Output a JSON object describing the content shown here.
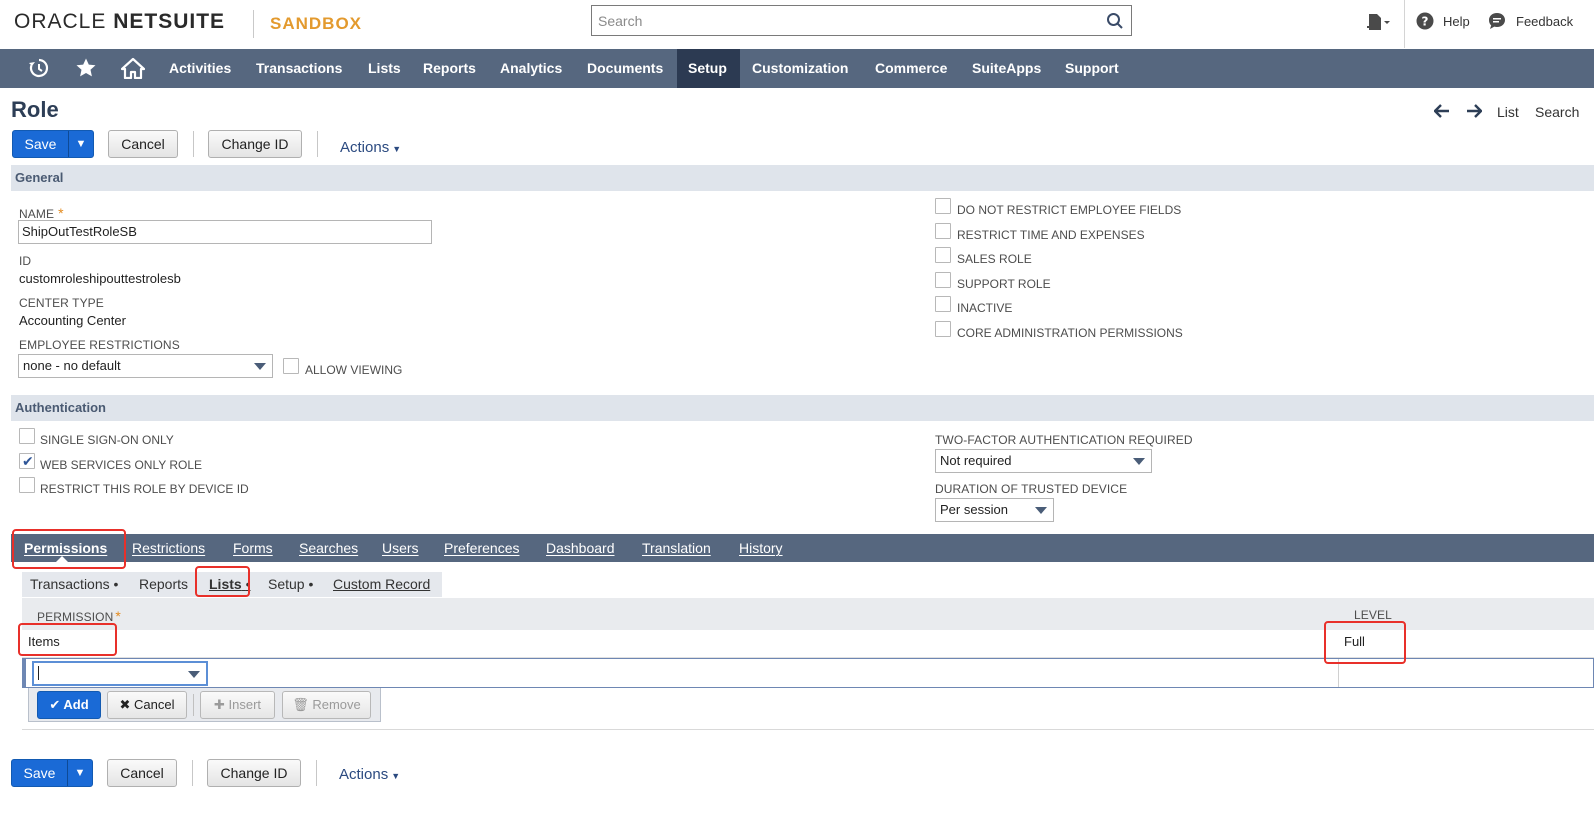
{
  "app": {
    "brand_oracle": "ORACLE",
    "brand_netsuite": "NETSUITE",
    "sandbox": "SANDBOX"
  },
  "search": {
    "placeholder": "Search"
  },
  "topbar": {
    "help": "Help",
    "feedback": "Feedback"
  },
  "nav": {
    "items": [
      {
        "label": "Activities"
      },
      {
        "label": "Transactions"
      },
      {
        "label": "Lists"
      },
      {
        "label": "Reports"
      },
      {
        "label": "Analytics"
      },
      {
        "label": "Documents"
      },
      {
        "label": "Setup",
        "active": true
      },
      {
        "label": "Customization"
      },
      {
        "label": "Commerce"
      },
      {
        "label": "SuiteApps"
      },
      {
        "label": "Support"
      }
    ]
  },
  "page": {
    "title": "Role",
    "nav_list": "List",
    "nav_search": "Search"
  },
  "toolbar": {
    "save": "Save",
    "cancel": "Cancel",
    "change_id": "Change ID",
    "actions": "Actions"
  },
  "general": {
    "header": "General",
    "name_label": "NAME",
    "name_value": "ShipOutTestRoleSB",
    "id_label": "ID",
    "id_value": "customroleshipouttestrolesb",
    "center_type_label": "CENTER TYPE",
    "center_type_value": "Accounting Center",
    "employee_restrictions_label": "EMPLOYEE RESTRICTIONS",
    "employee_restrictions_value": "none - no default",
    "allow_viewing": "ALLOW VIEWING",
    "checkboxes": [
      {
        "label": "DO NOT RESTRICT EMPLOYEE FIELDS",
        "checked": false
      },
      {
        "label": "RESTRICT TIME AND EXPENSES",
        "checked": false
      },
      {
        "label": "SALES ROLE",
        "checked": false
      },
      {
        "label": "SUPPORT ROLE",
        "checked": false
      },
      {
        "label": "INACTIVE",
        "checked": false
      },
      {
        "label": "CORE ADMINISTRATION PERMISSIONS",
        "checked": false
      }
    ]
  },
  "authentication": {
    "header": "Authentication",
    "sso": "SINGLE SIGN-ON ONLY",
    "web_services": "WEB SERVICES ONLY ROLE",
    "device_id": "RESTRICT THIS ROLE BY DEVICE ID",
    "two_factor_label": "TWO-FACTOR AUTHENTICATION REQUIRED",
    "two_factor_value": "Not required",
    "trusted_device_label": "DURATION OF TRUSTED DEVICE",
    "trusted_device_value": "Per session"
  },
  "tabs": [
    {
      "label": "Permissions",
      "active": true
    },
    {
      "label": "Restrictions"
    },
    {
      "label": "Forms"
    },
    {
      "label": "Searches"
    },
    {
      "label": "Users"
    },
    {
      "label": "Preferences"
    },
    {
      "label": "Dashboard"
    },
    {
      "label": "Translation"
    },
    {
      "label": "History"
    }
  ],
  "subtabs": [
    {
      "label": "Transactions",
      "dot": true
    },
    {
      "label": "Reports"
    },
    {
      "label": "Lists",
      "dot": true,
      "active": true
    },
    {
      "label": "Setup",
      "dot": true
    },
    {
      "label": "Custom Record"
    }
  ],
  "grid": {
    "col_permission": "PERMISSION",
    "col_level": "LEVEL",
    "rows": [
      {
        "permission": "Items",
        "level": "Full"
      }
    ],
    "add": "Add",
    "cancel": "Cancel",
    "insert": "Insert",
    "remove": "Remove"
  },
  "colors": {
    "nav_bg": "#56677f",
    "nav_active": "#2c3a52",
    "accent_blue": "#1a6ad6",
    "sandbox_orange": "#e39a2e",
    "highlight_red": "#e8302a"
  }
}
